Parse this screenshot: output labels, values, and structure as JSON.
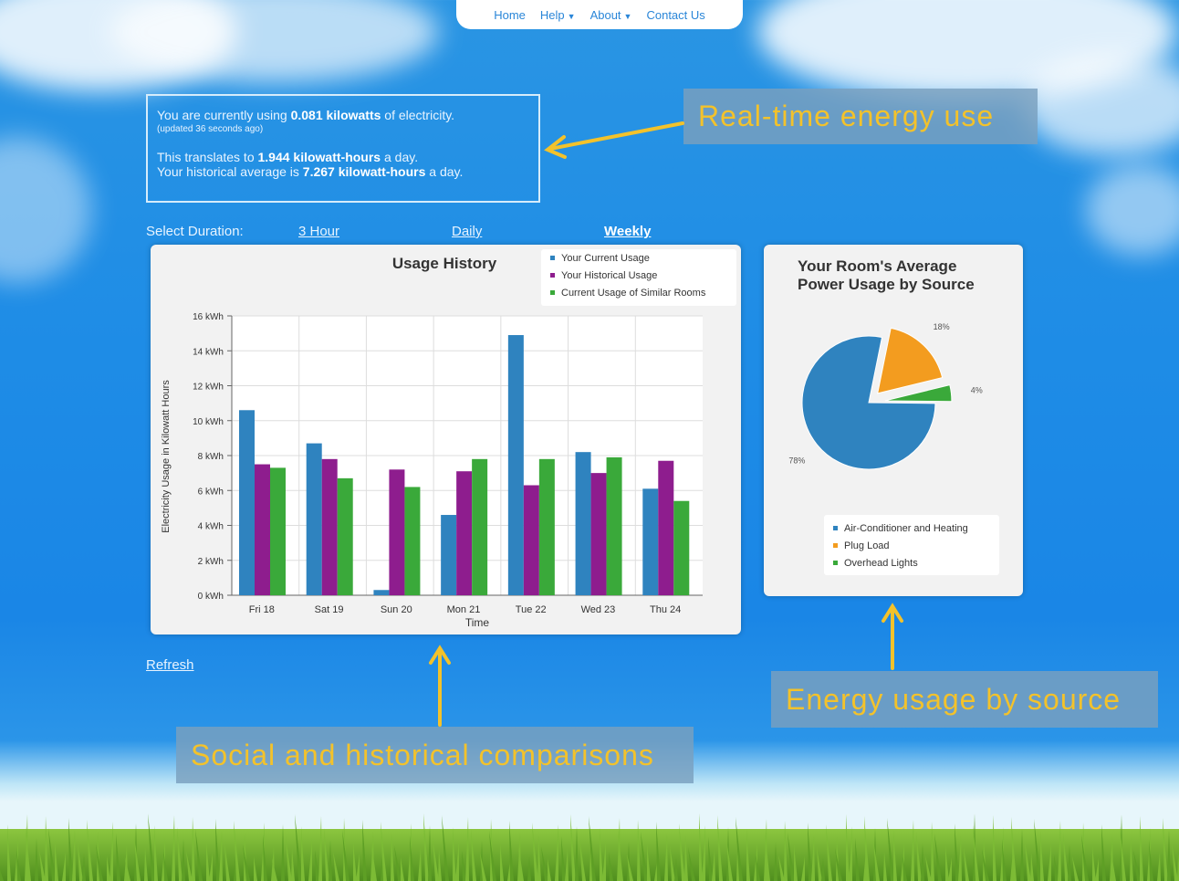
{
  "nav": {
    "home": "Home",
    "help": "Help",
    "about": "About",
    "contact": "Contact Us"
  },
  "info": {
    "line1_pre": "You are currently using ",
    "line1_value": "0.081 kilowatts",
    "line1_post": " of electricity.",
    "updated": "(updated 36 seconds ago)",
    "line2_pre": "This translates to ",
    "line2_value": "1.944 kilowatt-hours",
    "line2_post": " a day.",
    "line3_pre": "Your historical average is ",
    "line3_value": "7.267 kilowatt-hours",
    "line3_post": " a day."
  },
  "duration": {
    "label": "Select Duration:",
    "options": [
      "3 Hour",
      "Daily",
      "Weekly"
    ],
    "active": "Weekly"
  },
  "refresh_label": "Refresh",
  "callouts": {
    "realtime": "Real-time energy use",
    "source": "Energy usage by source",
    "social": "Social and historical comparisons"
  },
  "colors": {
    "current": "#2f83bf",
    "historical": "#8e1d8e",
    "similar": "#3aa93a",
    "aircon": "#2f83bf",
    "plug": "#f39c1f",
    "lights": "#3aa93a",
    "callout_text": "#f3c22b"
  },
  "chart_data": [
    {
      "type": "bar",
      "title": "Usage History",
      "xlabel": "Time",
      "ylabel": "Electricity Usage in Kilowatt Hours",
      "categories": [
        "Fri 18",
        "Sat 19",
        "Sun 20",
        "Mon 21",
        "Tue 22",
        "Wed 23",
        "Thu 24"
      ],
      "ylim": [
        0,
        16
      ],
      "yticks": [
        "0 kWh",
        "2 kWh",
        "4 kWh",
        "6 kWh",
        "8 kWh",
        "10 kWh",
        "12 kWh",
        "14 kWh",
        "16 kWh"
      ],
      "grid": true,
      "legend": "top-right",
      "series": [
        {
          "name": "Your Current Usage",
          "values": [
            10.6,
            8.7,
            0.3,
            4.6,
            14.9,
            8.2,
            6.1
          ]
        },
        {
          "name": "Your Historical Usage",
          "values": [
            7.5,
            7.8,
            7.2,
            7.1,
            6.3,
            7.0,
            7.7
          ]
        },
        {
          "name": "Current Usage of Similar Rooms",
          "values": [
            7.3,
            6.7,
            6.2,
            7.8,
            7.8,
            7.9,
            5.4
          ]
        }
      ]
    },
    {
      "type": "pie",
      "title": "Your Room's Average Power Usage by Source",
      "legend": "bottom",
      "slices": [
        {
          "name": "Air-Conditioner and Heating",
          "value": 78,
          "label": "78%"
        },
        {
          "name": "Plug Load",
          "value": 18,
          "label": "18%"
        },
        {
          "name": "Overhead Lights",
          "value": 4,
          "label": "4%"
        }
      ]
    }
  ]
}
